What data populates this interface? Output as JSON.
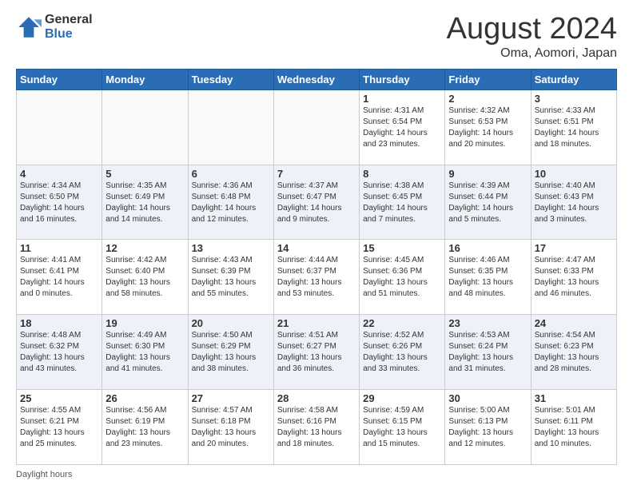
{
  "header": {
    "logo_general": "General",
    "logo_blue": "Blue",
    "month_year": "August 2024",
    "location": "Oma, Aomori, Japan"
  },
  "days_of_week": [
    "Sunday",
    "Monday",
    "Tuesday",
    "Wednesday",
    "Thursday",
    "Friday",
    "Saturday"
  ],
  "footer": {
    "daylight_label": "Daylight hours"
  },
  "weeks": [
    [
      {
        "day": "",
        "detail": ""
      },
      {
        "day": "",
        "detail": ""
      },
      {
        "day": "",
        "detail": ""
      },
      {
        "day": "",
        "detail": ""
      },
      {
        "day": "1",
        "detail": "Sunrise: 4:31 AM\nSunset: 6:54 PM\nDaylight: 14 hours\nand 23 minutes."
      },
      {
        "day": "2",
        "detail": "Sunrise: 4:32 AM\nSunset: 6:53 PM\nDaylight: 14 hours\nand 20 minutes."
      },
      {
        "day": "3",
        "detail": "Sunrise: 4:33 AM\nSunset: 6:51 PM\nDaylight: 14 hours\nand 18 minutes."
      }
    ],
    [
      {
        "day": "4",
        "detail": "Sunrise: 4:34 AM\nSunset: 6:50 PM\nDaylight: 14 hours\nand 16 minutes."
      },
      {
        "day": "5",
        "detail": "Sunrise: 4:35 AM\nSunset: 6:49 PM\nDaylight: 14 hours\nand 14 minutes."
      },
      {
        "day": "6",
        "detail": "Sunrise: 4:36 AM\nSunset: 6:48 PM\nDaylight: 14 hours\nand 12 minutes."
      },
      {
        "day": "7",
        "detail": "Sunrise: 4:37 AM\nSunset: 6:47 PM\nDaylight: 14 hours\nand 9 minutes."
      },
      {
        "day": "8",
        "detail": "Sunrise: 4:38 AM\nSunset: 6:45 PM\nDaylight: 14 hours\nand 7 minutes."
      },
      {
        "day": "9",
        "detail": "Sunrise: 4:39 AM\nSunset: 6:44 PM\nDaylight: 14 hours\nand 5 minutes."
      },
      {
        "day": "10",
        "detail": "Sunrise: 4:40 AM\nSunset: 6:43 PM\nDaylight: 14 hours\nand 3 minutes."
      }
    ],
    [
      {
        "day": "11",
        "detail": "Sunrise: 4:41 AM\nSunset: 6:41 PM\nDaylight: 14 hours\nand 0 minutes."
      },
      {
        "day": "12",
        "detail": "Sunrise: 4:42 AM\nSunset: 6:40 PM\nDaylight: 13 hours\nand 58 minutes."
      },
      {
        "day": "13",
        "detail": "Sunrise: 4:43 AM\nSunset: 6:39 PM\nDaylight: 13 hours\nand 55 minutes."
      },
      {
        "day": "14",
        "detail": "Sunrise: 4:44 AM\nSunset: 6:37 PM\nDaylight: 13 hours\nand 53 minutes."
      },
      {
        "day": "15",
        "detail": "Sunrise: 4:45 AM\nSunset: 6:36 PM\nDaylight: 13 hours\nand 51 minutes."
      },
      {
        "day": "16",
        "detail": "Sunrise: 4:46 AM\nSunset: 6:35 PM\nDaylight: 13 hours\nand 48 minutes."
      },
      {
        "day": "17",
        "detail": "Sunrise: 4:47 AM\nSunset: 6:33 PM\nDaylight: 13 hours\nand 46 minutes."
      }
    ],
    [
      {
        "day": "18",
        "detail": "Sunrise: 4:48 AM\nSunset: 6:32 PM\nDaylight: 13 hours\nand 43 minutes."
      },
      {
        "day": "19",
        "detail": "Sunrise: 4:49 AM\nSunset: 6:30 PM\nDaylight: 13 hours\nand 41 minutes."
      },
      {
        "day": "20",
        "detail": "Sunrise: 4:50 AM\nSunset: 6:29 PM\nDaylight: 13 hours\nand 38 minutes."
      },
      {
        "day": "21",
        "detail": "Sunrise: 4:51 AM\nSunset: 6:27 PM\nDaylight: 13 hours\nand 36 minutes."
      },
      {
        "day": "22",
        "detail": "Sunrise: 4:52 AM\nSunset: 6:26 PM\nDaylight: 13 hours\nand 33 minutes."
      },
      {
        "day": "23",
        "detail": "Sunrise: 4:53 AM\nSunset: 6:24 PM\nDaylight: 13 hours\nand 31 minutes."
      },
      {
        "day": "24",
        "detail": "Sunrise: 4:54 AM\nSunset: 6:23 PM\nDaylight: 13 hours\nand 28 minutes."
      }
    ],
    [
      {
        "day": "25",
        "detail": "Sunrise: 4:55 AM\nSunset: 6:21 PM\nDaylight: 13 hours\nand 25 minutes."
      },
      {
        "day": "26",
        "detail": "Sunrise: 4:56 AM\nSunset: 6:19 PM\nDaylight: 13 hours\nand 23 minutes."
      },
      {
        "day": "27",
        "detail": "Sunrise: 4:57 AM\nSunset: 6:18 PM\nDaylight: 13 hours\nand 20 minutes."
      },
      {
        "day": "28",
        "detail": "Sunrise: 4:58 AM\nSunset: 6:16 PM\nDaylight: 13 hours\nand 18 minutes."
      },
      {
        "day": "29",
        "detail": "Sunrise: 4:59 AM\nSunset: 6:15 PM\nDaylight: 13 hours\nand 15 minutes."
      },
      {
        "day": "30",
        "detail": "Sunrise: 5:00 AM\nSunset: 6:13 PM\nDaylight: 13 hours\nand 12 minutes."
      },
      {
        "day": "31",
        "detail": "Sunrise: 5:01 AM\nSunset: 6:11 PM\nDaylight: 13 hours\nand 10 minutes."
      }
    ]
  ]
}
